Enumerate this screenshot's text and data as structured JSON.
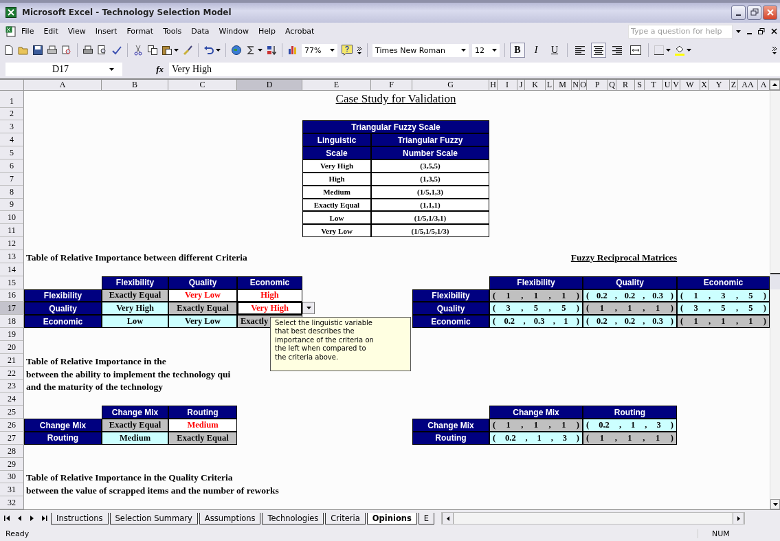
{
  "window": {
    "title": "Microsoft Excel - Technology Selection Model"
  },
  "menu": [
    "File",
    "Edit",
    "View",
    "Insert",
    "Format",
    "Tools",
    "Data",
    "Window",
    "Help",
    "Acrobat"
  ],
  "help_box": {
    "placeholder": "Type a question for help"
  },
  "toolbar": {
    "zoom": "77%",
    "font": "Times New Roman",
    "size": "12"
  },
  "format_buttons": [
    {
      "kind": "bold",
      "label": "B",
      "selected": true
    },
    {
      "kind": "italic",
      "label": "I",
      "selected": false
    },
    {
      "kind": "underline",
      "label": "U",
      "selected": false
    },
    {
      "kind": "align-left",
      "selected": false
    },
    {
      "kind": "align-center",
      "selected": true
    },
    {
      "kind": "align-right",
      "selected": false
    },
    {
      "kind": "merge",
      "selected": false
    }
  ],
  "formula_bar": {
    "cell": "D17",
    "fx": "fx",
    "value": "Very High"
  },
  "column_headers": [
    {
      "label": "A",
      "selected": false
    },
    {
      "label": "B",
      "selected": false
    },
    {
      "label": "C",
      "selected": false
    },
    {
      "label": "D",
      "selected": true
    },
    {
      "label": "E",
      "selected": false
    },
    {
      "label": "F",
      "selected": false
    },
    {
      "label": "G",
      "selected": false
    },
    {
      "label": "H",
      "selected": false
    },
    {
      "label": "I",
      "selected": false
    },
    {
      "label": "J",
      "selected": false
    },
    {
      "label": "K",
      "selected": false
    },
    {
      "label": "L",
      "selected": false
    },
    {
      "label": "M",
      "selected": false
    },
    {
      "label": "N",
      "selected": false
    },
    {
      "label": "O",
      "selected": false
    },
    {
      "label": "P",
      "selected": false
    },
    {
      "label": "Q",
      "selected": false
    },
    {
      "label": "R",
      "selected": false
    },
    {
      "label": "S",
      "selected": false
    },
    {
      "label": "T",
      "selected": false
    },
    {
      "label": "U",
      "selected": false
    },
    {
      "label": "V",
      "selected": false
    },
    {
      "label": "W",
      "selected": false
    },
    {
      "label": "X",
      "selected": false
    },
    {
      "label": "Y",
      "selected": false
    },
    {
      "label": "Z",
      "selected": false
    },
    {
      "label": "AA",
      "selected": false
    },
    {
      "label": "A",
      "selected": false
    }
  ],
  "row_headers": [
    {
      "label": "1",
      "selected": false
    },
    {
      "label": "2",
      "selected": false
    },
    {
      "label": "3",
      "selected": false
    },
    {
      "label": "4",
      "selected": false
    },
    {
      "label": "5",
      "selected": false
    },
    {
      "label": "6",
      "selected": false
    },
    {
      "label": "7",
      "selected": false
    },
    {
      "label": "8",
      "selected": false
    },
    {
      "label": "9",
      "selected": false
    },
    {
      "label": "10",
      "selected": false
    },
    {
      "label": "11",
      "selected": false
    },
    {
      "label": "12",
      "selected": false
    },
    {
      "label": "13",
      "selected": false
    },
    {
      "label": "14",
      "selected": false
    },
    {
      "label": "15",
      "selected": false
    },
    {
      "label": "16",
      "selected": false
    },
    {
      "label": "17",
      "selected": true
    },
    {
      "label": "18",
      "selected": false
    },
    {
      "label": "19",
      "selected": false
    },
    {
      "label": "20",
      "selected": false
    },
    {
      "label": "21",
      "selected": false
    },
    {
      "label": "22",
      "selected": false
    },
    {
      "label": "23",
      "selected": false
    },
    {
      "label": "24",
      "selected": false
    },
    {
      "label": "25",
      "selected": false
    },
    {
      "label": "26",
      "selected": false
    },
    {
      "label": "27",
      "selected": false
    },
    {
      "label": "28",
      "selected": false
    },
    {
      "label": "29",
      "selected": false
    },
    {
      "label": "30",
      "selected": false
    },
    {
      "label": "31",
      "selected": false
    },
    {
      "label": "32",
      "selected": false
    }
  ],
  "sheet": {
    "title": "Case Study for Validation",
    "scale_table": {
      "title": "Triangular Fuzzy Scale",
      "header_rows": [
        [
          "Linguistic",
          "Triangular Fuzzy"
        ],
        [
          "Scale",
          "Number Scale"
        ]
      ],
      "rows": [
        [
          "Very High",
          "(3,5,5)"
        ],
        [
          "High",
          "(1,3,5)"
        ],
        [
          "Medium",
          "(1/5,1,3)"
        ],
        [
          "Exactly Equal",
          "(1,1,1)"
        ],
        [
          "Low",
          "(1/5,1/3,1)"
        ],
        [
          "Very Low",
          "(1/5,1/5,1/3)"
        ]
      ]
    },
    "headings": [
      "Table of Relative Importance between different Criteria",
      "Table of Relative Importance in the",
      "between the ability to implement the technology qui",
      "and the maturity of the technology",
      "Table of Relative Importance in the Quality Criteria",
      "between the value of scrapped items and the number of reworks"
    ],
    "matrix_title": "Fuzzy Reciprocal Matrices",
    "tables": [
      {
        "columns": [
          "Flexibility",
          "Quality",
          "Economic"
        ],
        "rows": [
          {
            "label": "Flexibility",
            "cells": [
              {
                "text": "Exactly Equal",
                "kind": "diagonal",
                "selected": false
              },
              {
                "text": "Very Low",
                "kind": "input",
                "selected": false
              },
              {
                "text": "High",
                "kind": "input",
                "selected": false
              }
            ]
          },
          {
            "label": "Quality",
            "cells": [
              {
                "text": "Very High",
                "kind": "reciprocal",
                "selected": false
              },
              {
                "text": "Exactly Equal",
                "kind": "diagonal",
                "selected": false
              },
              {
                "text": "Very High",
                "kind": "input",
                "selected": true
              }
            ]
          },
          {
            "label": "Economic",
            "cells": [
              {
                "text": "Low",
                "kind": "reciprocal",
                "selected": false
              },
              {
                "text": "Very Low",
                "kind": "reciprocal",
                "selected": false
              },
              {
                "text": "Exactly",
                "kind": "diagonal",
                "selected": false
              }
            ]
          }
        ]
      },
      {
        "columns": [
          "Change Mix",
          "Routing"
        ],
        "rows": [
          {
            "label": "Change Mix",
            "cells": [
              {
                "text": "Exactly Equal",
                "kind": "diagonal",
                "selected": false
              },
              {
                "text": "Medium",
                "kind": "input",
                "selected": false
              }
            ]
          },
          {
            "label": "Routing",
            "cells": [
              {
                "text": "Medium",
                "kind": "reciprocal",
                "selected": false
              },
              {
                "text": "Exactly Equal",
                "kind": "diagonal",
                "selected": false
              }
            ]
          }
        ]
      }
    ],
    "matrices": [
      {
        "columns": [
          "Flexibility",
          "Quality",
          "Economic"
        ],
        "rows": [
          {
            "label": "Flexibility",
            "cells": [
              {
                "text": "( 1 , 1 , 1 )",
                "kind": "diagonal"
              },
              {
                "text": "( 0.2 , 0.2 , 0.3 )",
                "kind": "reciprocal"
              },
              {
                "text": "( 1 , 3 , 5 )",
                "kind": "reciprocal"
              }
            ]
          },
          {
            "label": "Quality",
            "cells": [
              {
                "text": "( 3 , 5 , 5 )",
                "kind": "reciprocal"
              },
              {
                "text": "( 1 , 1 , 1 )",
                "kind": "diagonal"
              },
              {
                "text": "( 3 , 5 , 5 )",
                "kind": "reciprocal"
              }
            ]
          },
          {
            "label": "Economic",
            "cells": [
              {
                "text": "( 0.2 , 0.3 , 1 )",
                "kind": "reciprocal"
              },
              {
                "text": "( 0.2 , 0.2 , 0.3 )",
                "kind": "reciprocal"
              },
              {
                "text": "( 1 , 1 , 1 )",
                "kind": "diagonal"
              }
            ]
          }
        ]
      },
      {
        "columns": [
          "Change Mix",
          "Routing"
        ],
        "rows": [
          {
            "label": "Change Mix",
            "cells": [
              {
                "text": "( 1 , 1 , 1 )",
                "kind": "diagonal"
              },
              {
                "text": "( 0.2 , 1 , 3 )",
                "kind": "reciprocal"
              }
            ]
          },
          {
            "label": "Routing",
            "cells": [
              {
                "text": "( 0.2 , 1 , 3 )",
                "kind": "reciprocal"
              },
              {
                "text": "( 1 , 1 , 1 )",
                "kind": "diagonal"
              }
            ]
          }
        ]
      }
    ]
  },
  "input_message": {
    "text": "Select the linguistic variable that best describes the importance of the criteria on the left when compared to the criteria above."
  },
  "sheet_tabs": [
    {
      "label": "Instructions",
      "selected": false
    },
    {
      "label": "Selection Summary",
      "selected": false
    },
    {
      "label": "Assumptions",
      "selected": false
    },
    {
      "label": "Technologies",
      "selected": false
    },
    {
      "label": "Criteria",
      "selected": false
    },
    {
      "label": "Opinions",
      "selected": true
    },
    {
      "label": "E",
      "selected": false
    }
  ],
  "status_bar": {
    "text": "Ready",
    "num": "NUM"
  }
}
